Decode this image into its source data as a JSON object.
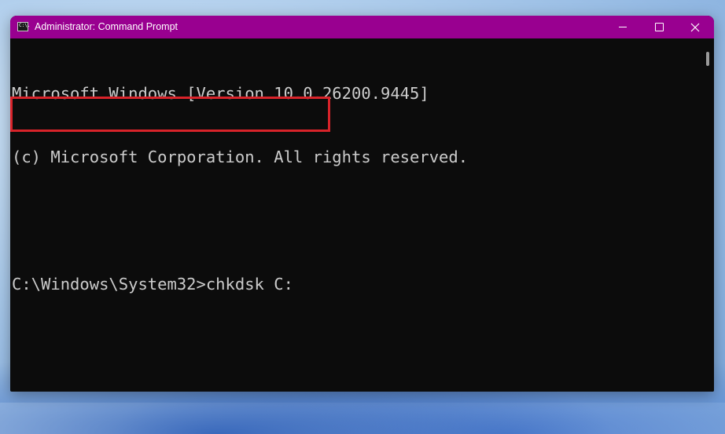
{
  "window": {
    "title": "Administrator: Command Prompt",
    "titlebar_color": "#990090",
    "icon": "command-prompt-icon",
    "icon_glyph": "C:\\."
  },
  "controls": {
    "minimize_icon": "minimize-icon",
    "maximize_icon": "maximize-icon",
    "close_icon": "close-icon",
    "close_glyph": "✕"
  },
  "console": {
    "background": "#0c0c0c",
    "text_color": "#cccccc",
    "lines": [
      "Microsoft Windows [Version 10.0.26200.9445]",
      "(c) Microsoft Corporation. All rights reserved.",
      "",
      "C:\\Windows\\System32>chkdsk C:"
    ],
    "highlight_color": "#d8232a"
  }
}
